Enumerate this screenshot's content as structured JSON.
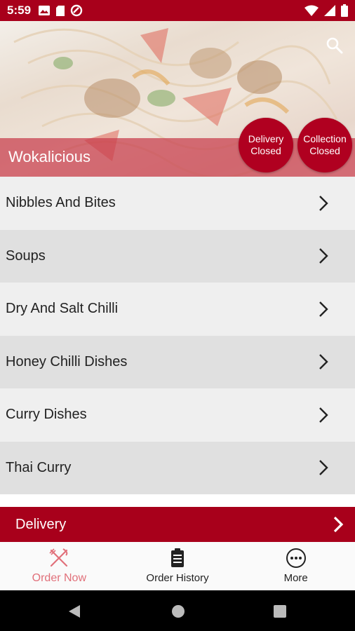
{
  "status_bar": {
    "time": "5:59"
  },
  "header": {
    "restaurant_name": "Wokalicious",
    "delivery_status_line1": "Delivery",
    "delivery_status_line2": "Closed",
    "collection_status_line1": "Collection",
    "collection_status_line2": "Closed"
  },
  "menu": {
    "categories": [
      {
        "label": "Nibbles And Bites"
      },
      {
        "label": "Soups"
      },
      {
        "label": "Dry And Salt Chilli"
      },
      {
        "label": "Honey Chilli Dishes"
      },
      {
        "label": "Curry Dishes"
      },
      {
        "label": "Thai Curry"
      }
    ]
  },
  "order_mode": {
    "label": "Delivery"
  },
  "bottom_nav": {
    "tabs": [
      {
        "label": "Order Now",
        "icon": "fork-knife-icon",
        "active": true
      },
      {
        "label": "Order History",
        "icon": "clipboard-icon",
        "active": false
      },
      {
        "label": "More",
        "icon": "more-icon",
        "active": false
      }
    ]
  },
  "colors": {
    "brand": "#a8001b",
    "badge": "#b00020",
    "active_tab": "#e1707a"
  }
}
